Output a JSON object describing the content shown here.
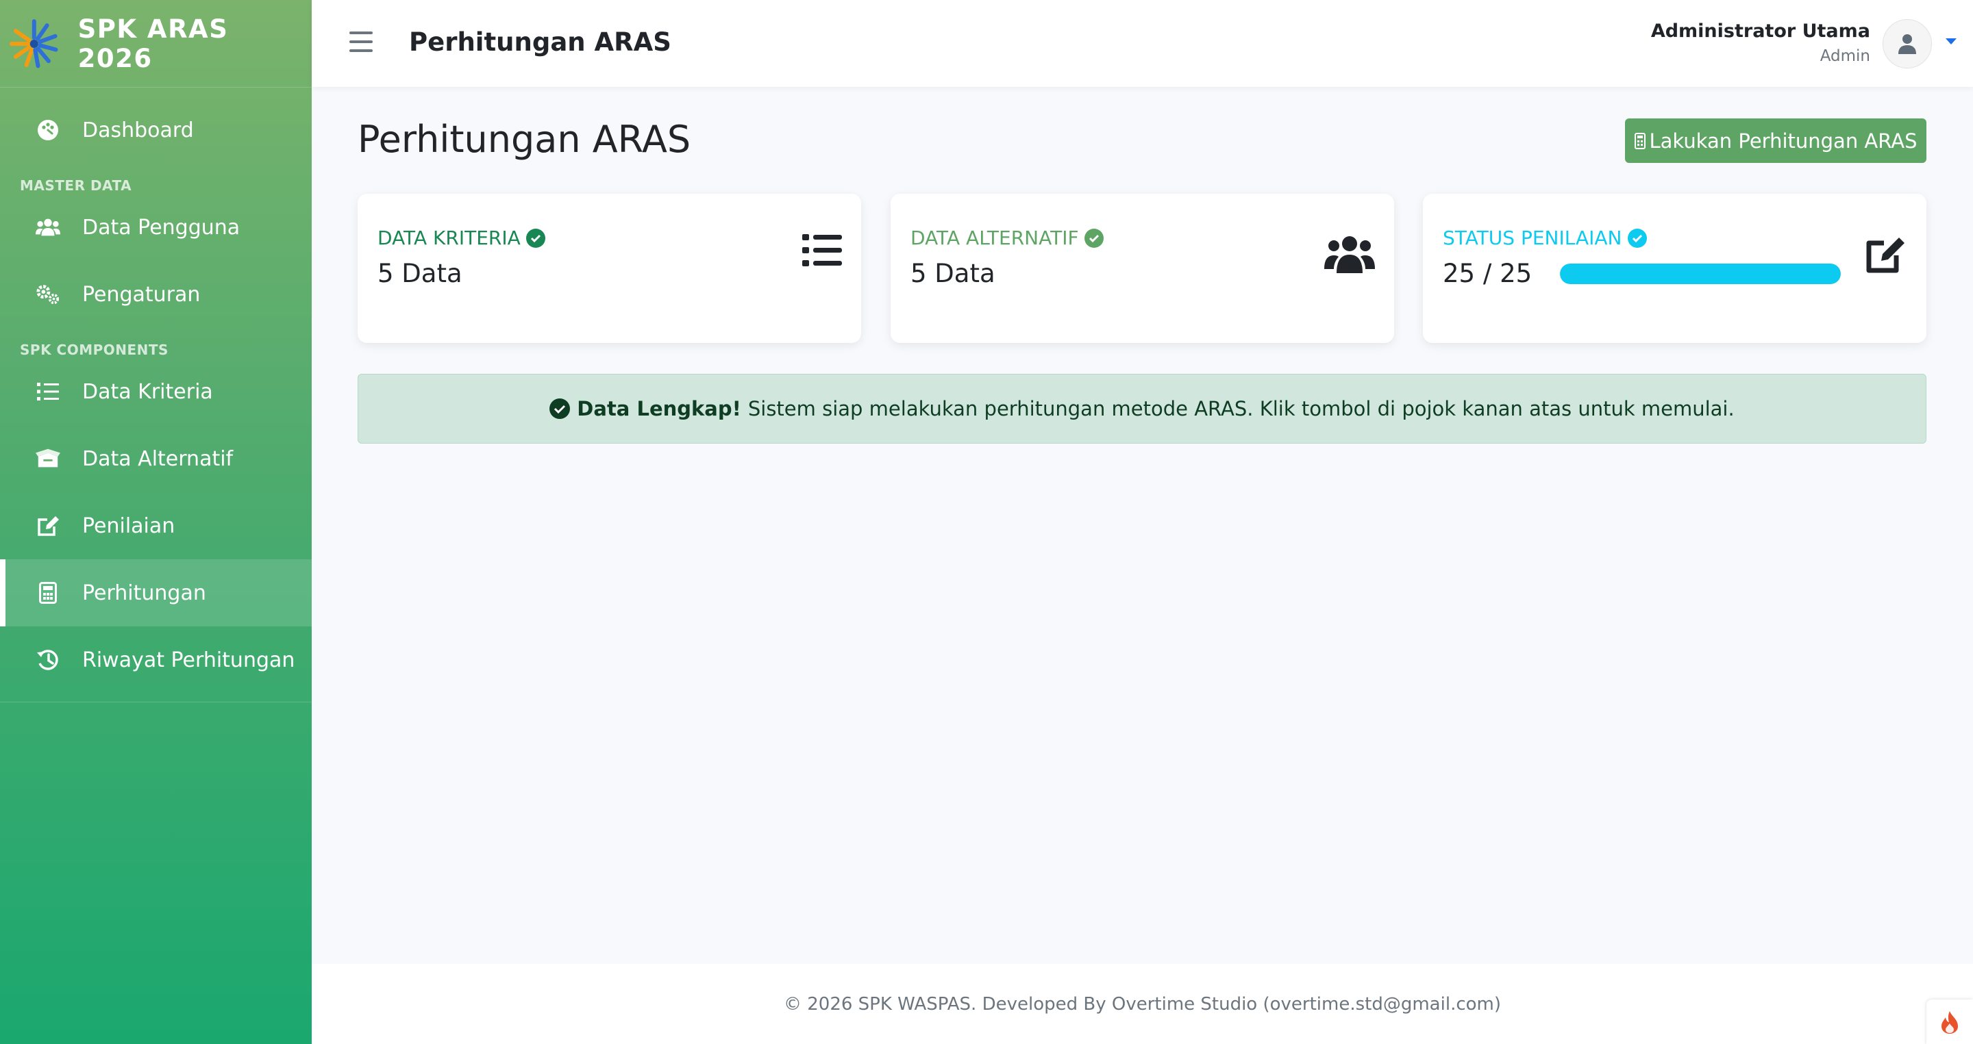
{
  "brand": {
    "title": "SPK ARAS 2026",
    "logo_icon": "spark-logo-icon"
  },
  "sidebar": {
    "items": [
      {
        "label": "Dashboard",
        "icon": "palette-icon"
      },
      {
        "heading": "MASTER DATA"
      },
      {
        "label": "Data Pengguna",
        "icon": "users-icon"
      },
      {
        "label": "Pengaturan",
        "icon": "gears-icon"
      },
      {
        "heading": "SPK COMPONENTS"
      },
      {
        "label": "Data Kriteria",
        "icon": "list-icon"
      },
      {
        "label": "Data Alternatif",
        "icon": "box-open-icon"
      },
      {
        "label": "Penilaian",
        "icon": "edit-icon"
      },
      {
        "label": "Perhitungan",
        "icon": "calculator-icon",
        "active": true
      },
      {
        "label": "Riwayat Perhitungan",
        "icon": "history-icon"
      }
    ]
  },
  "topbar": {
    "title": "Perhitungan ARAS",
    "user_name": "Administrator Utama",
    "user_role": "Admin"
  },
  "main": {
    "heading": "Perhitungan ARAS",
    "action_button": "Lakukan Perhitungan ARAS",
    "cards": [
      {
        "label": "DATA KRITERIA",
        "value": "5 Data",
        "color": "#198754",
        "icon": "list-icon"
      },
      {
        "label": "DATA ALTERNATIF",
        "value": "5 Data",
        "color": "#5ea565",
        "icon": "users-icon"
      },
      {
        "label": "STATUS PENILAIAN",
        "value": "25 / 25",
        "color": "#0dcaf0",
        "icon": "edit-icon",
        "progress": 1.0
      }
    ],
    "alert": {
      "strong": "Data Lengkap!",
      "text": "Sistem siap melakukan perhitungan metode ARAS. Klik tombol di pojok kanan atas untuk memulai."
    }
  },
  "footer": {
    "text": "© 2026 SPK WASPAS. Developed By Overtime Studio (overtime.std@gmail.com)"
  },
  "colors": {
    "primary": "#5ea565",
    "info": "#0dcaf0",
    "success": "#198754"
  }
}
